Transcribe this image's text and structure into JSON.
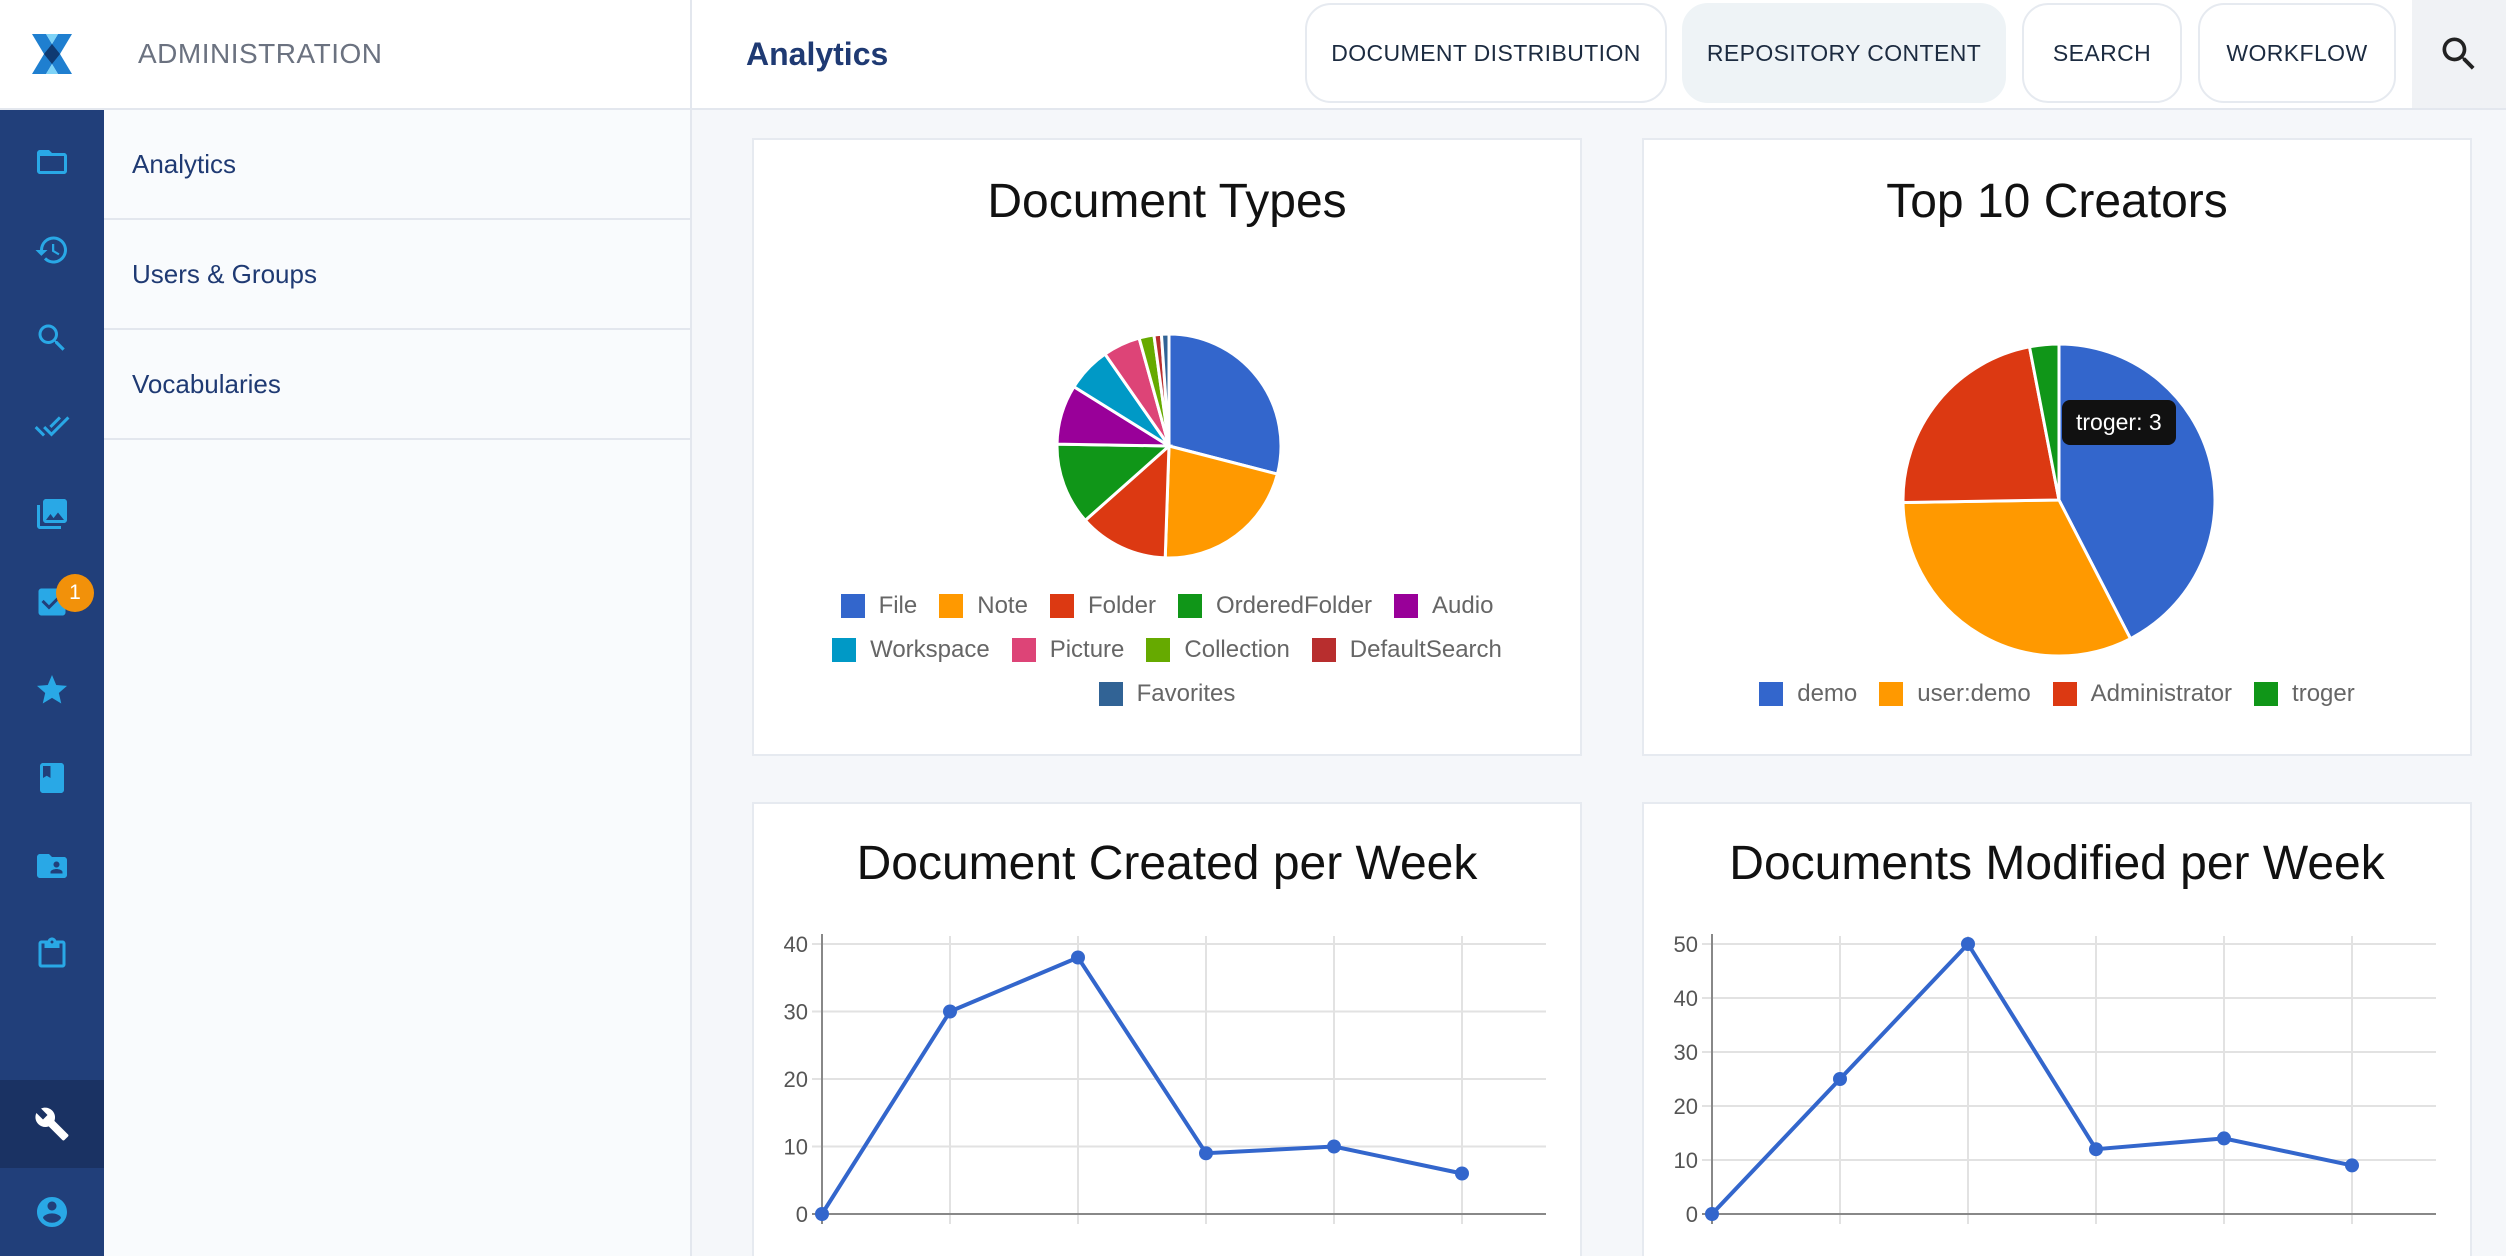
{
  "header": {
    "section_title": "ADMINISTRATION",
    "page_title": "Analytics",
    "tabs": [
      {
        "label": "DOCUMENT DISTRIBUTION",
        "active": false
      },
      {
        "label": "REPOSITORY CONTENT",
        "active": true
      },
      {
        "label": "SEARCH",
        "active": false
      },
      {
        "label": "WORKFLOW",
        "active": false
      }
    ]
  },
  "rail": {
    "items": [
      "folder-icon",
      "history-icon",
      "search-icon",
      "done-all-icon",
      "photo-library-icon",
      "tasks-icon",
      "star-icon",
      "book-icon",
      "shared-folder-icon",
      "clipboard-icon",
      "wrench-icon",
      "account-icon"
    ],
    "tasks_badge": "1"
  },
  "panel": {
    "items": [
      "Analytics",
      "Users & Groups",
      "Vocabularies"
    ]
  },
  "colors": {
    "accent": "#213f7a",
    "icon": "#29a8e6",
    "line": "#3366cc"
  },
  "chart_data": [
    {
      "type": "pie",
      "title": "Document Types",
      "categories": [
        "File",
        "Note",
        "Folder",
        "OrderedFolder",
        "Audio",
        "Workspace",
        "Picture",
        "Collection",
        "DefaultSearch",
        "Favorites"
      ],
      "values": [
        27,
        20,
        12,
        11,
        8,
        6,
        5,
        2,
        1,
        1
      ],
      "colors": [
        "#3366cc",
        "#ff9900",
        "#dc3912",
        "#109618",
        "#990099",
        "#0099c6",
        "#dd4477",
        "#66aa00",
        "#b82e2e",
        "#316395"
      ],
      "legend": "bottom"
    },
    {
      "type": "pie",
      "title": "Top 10 Creators",
      "categories": [
        "demo",
        "user:demo",
        "Administrator",
        "troger"
      ],
      "values": [
        42,
        32,
        22,
        3
      ],
      "colors": [
        "#3366cc",
        "#ff9900",
        "#dc3912",
        "#109618"
      ],
      "legend": "bottom",
      "tooltip": "troger: 3"
    },
    {
      "type": "line",
      "title": "Document Created per Week",
      "values": [
        0,
        30,
        38,
        9,
        10,
        6
      ],
      "yticks": [
        0,
        10,
        20,
        30,
        40
      ],
      "ylim": [
        0,
        40
      ],
      "grid": true
    },
    {
      "type": "line",
      "title": "Documents Modified per Week",
      "values": [
        0,
        25,
        50,
        12,
        14,
        9
      ],
      "yticks": [
        0,
        10,
        20,
        30,
        40,
        50
      ],
      "ylim": [
        0,
        50
      ],
      "grid": true
    }
  ]
}
